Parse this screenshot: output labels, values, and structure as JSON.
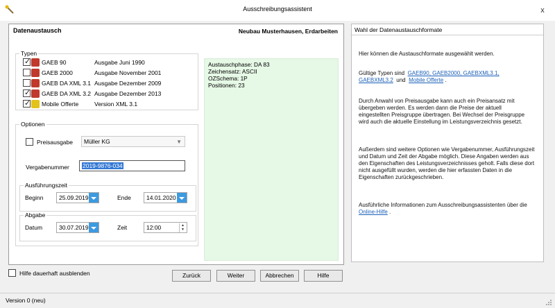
{
  "window": {
    "title": "Ausschreibungsassistent",
    "close": "x"
  },
  "main": {
    "title": "Datenaustausch",
    "project": "Neubau Musterhausen, Erdarbeiten",
    "typen": {
      "legend": "Typen",
      "items": [
        {
          "name": "GAEB 90",
          "desc": "Ausgabe Juni 1990",
          "checked": true,
          "icon_color": "#c0392b"
        },
        {
          "name": "GAEB 2000",
          "desc": "Ausgabe November 2001",
          "checked": false,
          "icon_color": "#c0392b"
        },
        {
          "name": "GAEB DA XML 3.1",
          "desc": "Ausgabe Dezember 2009",
          "checked": false,
          "icon_color": "#c0392b"
        },
        {
          "name": "GAEB DA XML 3.2",
          "desc": "Ausgabe Dezember 2013",
          "checked": true,
          "icon_color": "#c0392b"
        },
        {
          "name": "Mobile Offerte",
          "desc": "Version XML 3.1",
          "checked": true,
          "icon_color": "#e3c21b"
        }
      ]
    },
    "optionen": {
      "legend": "Optionen",
      "preisausgabe_label": "Preisausgabe",
      "preisausgabe_value": "Müller KG",
      "vergabenummer_label": "Vergabenummer",
      "vergabenummer_value": "2019-9876-034",
      "ausfuehrung": {
        "legend": "Ausführungszeit",
        "beginn_label": "Beginn",
        "beginn_value": "25.09.2019",
        "ende_label": "Ende",
        "ende_value": "14.01.2020"
      },
      "abgabe": {
        "legend": "Abgabe",
        "datum_label": "Datum",
        "datum_value": "30.07.2019",
        "zeit_label": "Zeit",
        "zeit_value": "12:00"
      }
    },
    "info": {
      "l1": "Austauschphase: DA 83",
      "l2": "Zeichensatz: ASCII",
      "l3": "OZSchema: 1P",
      "l4": "Positionen: 23"
    }
  },
  "help": {
    "title": "Wahl der Datenaustauschformate",
    "p1": "Hier können die Austauschformate ausgewählt werden.",
    "p2_pre": "Gültige Typen sind",
    "p2_link1": "GAEB90, GAEB2000, GAEBXML3.1,",
    "p2_link1b": "GAEBXML3.2",
    "p2_mid": "und",
    "p2_link2": "Mobile Offerte",
    "p2_end": ".",
    "p3": "Durch Anwahl von Preisausgabe kann auch ein Preisansatz mit übergeben werden. Es werden dann die Preise der aktuell eingestellten Preisgruppe übertragen. Bei Wechsel der Preisgruppe wird auch die aktuelle Einstellung im Leistungsverzeichnis gesetzt.",
    "p4": "Außerdem sind weitere Optionen wie Vergabenummer, Ausführungszeit und Datum und Zeit der Abgabe möglich. Diese Angaben werden aus den Eigenschaften des Leistungsverzeichnisses geholt. Falls diese dort nicht ausgefüllt wurden, werden die hier erfassten Daten in die Eigenschaften zurückgeschrieben.",
    "p5_pre": "Ausführliche Informationen zum Ausschreibungsassistenten über die",
    "p5_link": "Online-Hilfe",
    "p5_end": "."
  },
  "footer": {
    "hide_help": "Hilfe dauerhaft ausblenden",
    "back": "Zurück",
    "next": "Weiter",
    "cancel": "Abbrechen",
    "help": "Hilfe"
  },
  "status": {
    "version": "Version 0 (neu)"
  }
}
